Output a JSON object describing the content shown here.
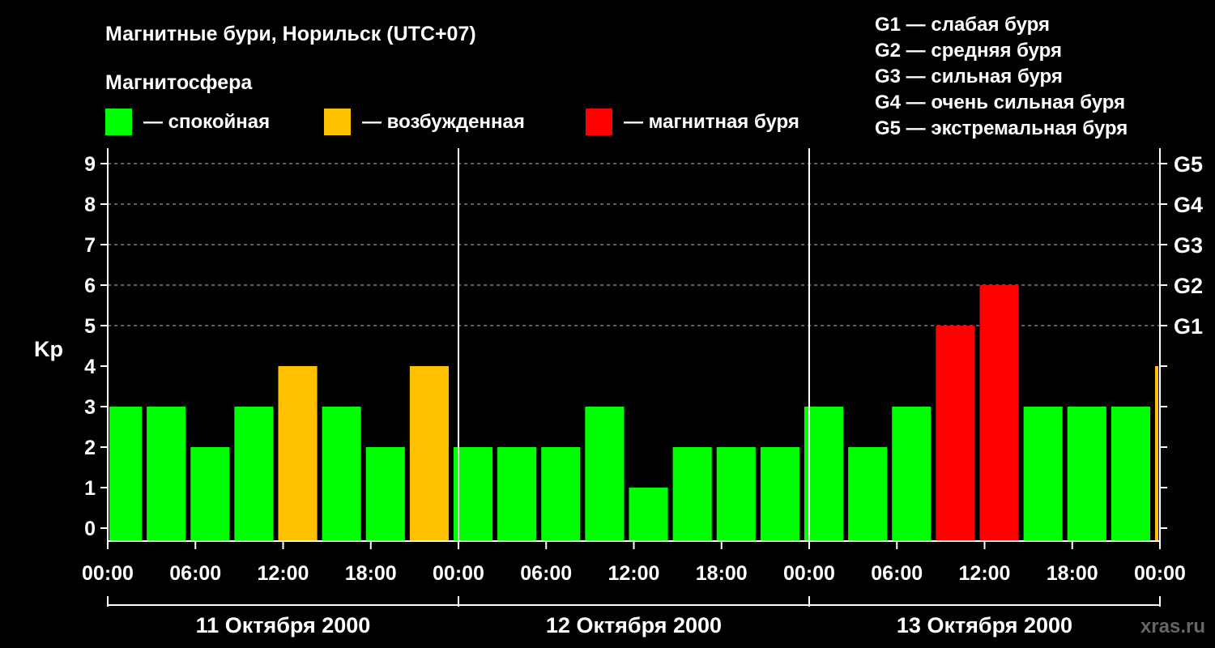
{
  "chart_data": {
    "type": "bar",
    "title": "Магнитные бури, Норильск (UTC+07)",
    "legend_title": "Магнитосфера",
    "legend": [
      {
        "key": "calm",
        "label": "— спокойная",
        "color": "#00ff00"
      },
      {
        "key": "active",
        "label": "— возбужденная",
        "color": "#ffc000"
      },
      {
        "key": "storm",
        "label": "— магнитная буря",
        "color": "#ff0000"
      }
    ],
    "g_scale": [
      "G1 — слабая буря",
      "G2 — средняя буря",
      "G3 — сильная буря",
      "G4 — очень сильная буря",
      "G5 — экстремальная буря"
    ],
    "ylabel": "Kp",
    "ylim": [
      0,
      9
    ],
    "y_ticks": [
      "0",
      "1",
      "2",
      "3",
      "4",
      "5",
      "6",
      "7",
      "8",
      "9"
    ],
    "g_levels": [
      {
        "label": "G1",
        "kp": 5
      },
      {
        "label": "G2",
        "kp": 6
      },
      {
        "label": "G3",
        "kp": 7
      },
      {
        "label": "G4",
        "kp": 8
      },
      {
        "label": "G5",
        "kp": 9
      }
    ],
    "x_ticks": [
      "00:00",
      "06:00",
      "12:00",
      "18:00",
      "00:00",
      "06:00",
      "12:00",
      "18:00",
      "00:00",
      "06:00",
      "12:00",
      "18:00",
      "00:00"
    ],
    "days": [
      "11 Октября 2000",
      "12 Октября 2000",
      "13 Октября 2000"
    ],
    "interval_hours": 3,
    "start_hour": 1,
    "values": [
      3,
      3,
      2,
      3,
      4,
      3,
      2,
      4,
      2,
      2,
      2,
      3,
      1,
      2,
      2,
      2,
      3,
      2,
      3,
      5,
      6,
      3,
      3,
      3,
      4
    ],
    "categories": [
      "calm",
      "calm",
      "calm",
      "calm",
      "active",
      "calm",
      "calm",
      "active",
      "calm",
      "calm",
      "calm",
      "calm",
      "calm",
      "calm",
      "calm",
      "calm",
      "calm",
      "calm",
      "calm",
      "storm",
      "storm",
      "calm",
      "calm",
      "calm",
      "active"
    ],
    "grid": true,
    "watermark": "xras.ru"
  }
}
